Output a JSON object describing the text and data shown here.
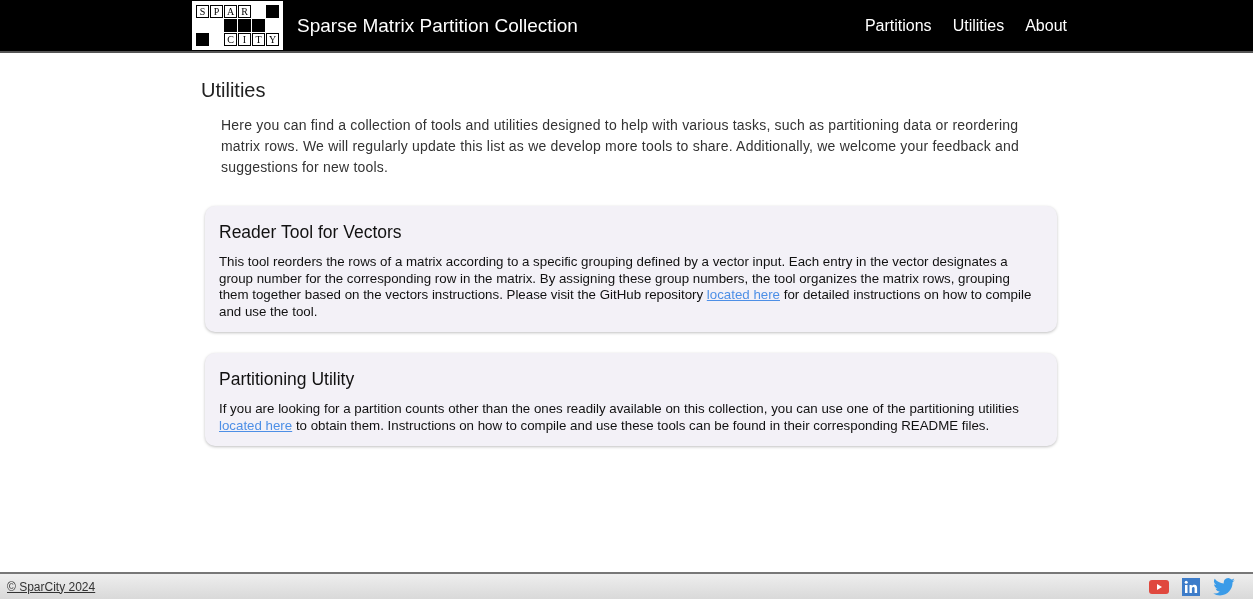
{
  "header": {
    "logo": {
      "top_letters": [
        "S",
        "P",
        "A",
        "R"
      ],
      "bottom_letters": [
        "C",
        "I",
        "T",
        "Y"
      ]
    },
    "title": "Sparse Matrix Partition Collection",
    "nav": [
      {
        "label": "Partitions"
      },
      {
        "label": "Utilities"
      },
      {
        "label": "About"
      }
    ]
  },
  "page": {
    "heading": "Utilities",
    "intro": "Here you can find a collection of tools and utilities designed to help with various tasks, such as partitioning data or reordering matrix rows. We will regularly update this list as we develop more tools to share. Additionally, we welcome your feedback and suggestions for new tools."
  },
  "cards": [
    {
      "title": "Reader Tool for Vectors",
      "before": "This tool reorders the rows of a matrix according to a specific grouping defined by a vector input. Each entry in the vector designates a group number for the corresponding row in the matrix. By assigning these group numbers, the tool organizes the matrix rows, grouping them together based on the vectors instructions. Please visit the GitHub repository",
      "link": "located here",
      "after": "for detailed instructions on how to compile and use the tool."
    },
    {
      "title": "Partitioning Utility",
      "before": "If you are looking for a partition counts other than the ones readily available on this collection, you can use one of the partitioning utilities",
      "link": "located here",
      "after": "to obtain them. Instructions on how to compile and use these tools can be found in their corresponding README files."
    }
  ],
  "footer": {
    "copyright": "© SparCity 2024",
    "social": [
      {
        "kind": "youtube"
      },
      {
        "kind": "linkedin"
      },
      {
        "kind": "twitter"
      }
    ]
  }
}
